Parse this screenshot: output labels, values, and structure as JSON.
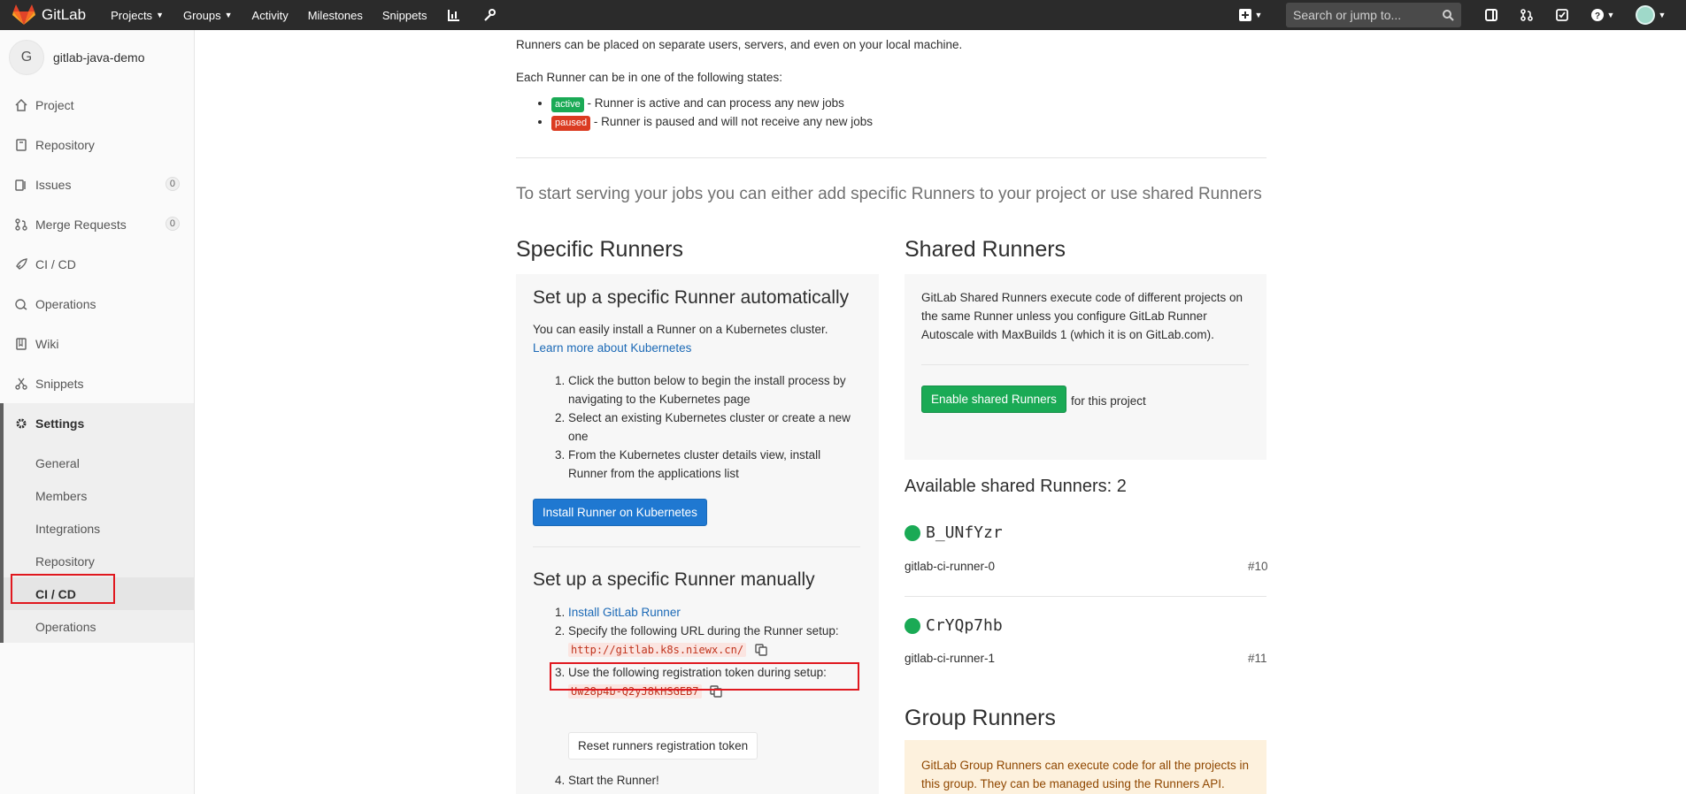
{
  "navbar": {
    "brand": "GitLab",
    "links": [
      "Projects",
      "Groups",
      "Activity",
      "Milestones",
      "Snippets"
    ],
    "search_placeholder": "Search or jump to...",
    "accent": "#2b2b2b"
  },
  "sidebar": {
    "avatar_letter": "G",
    "project_name": "gitlab-java-demo",
    "items": [
      {
        "label": "Project",
        "icon": "home-icon"
      },
      {
        "label": "Repository",
        "icon": "doc-icon"
      },
      {
        "label": "Issues",
        "icon": "issues-icon",
        "count": "0"
      },
      {
        "label": "Merge Requests",
        "icon": "merge-icon",
        "count": "0"
      },
      {
        "label": "CI / CD",
        "icon": "rocket-icon"
      },
      {
        "label": "Operations",
        "icon": "cloud-icon"
      },
      {
        "label": "Wiki",
        "icon": "book-icon"
      },
      {
        "label": "Snippets",
        "icon": "scissors-icon"
      }
    ],
    "settings_label": "Settings",
    "sub_items": [
      "General",
      "Members",
      "Integrations",
      "Repository",
      "CI / CD",
      "Operations"
    ],
    "active_sub": "CI / CD"
  },
  "intro": {
    "line1": "Runners can be placed on separate users, servers, and even on your local machine.",
    "states_heading": "Each Runner can be in one of the following states:",
    "active_badge": "active",
    "active_text": " - Runner is active and can process any new jobs",
    "paused_badge": "paused",
    "paused_text": " - Runner is paused and will not receive any new jobs",
    "lead": "To start serving your jobs you can either add specific Runners to your project or use shared Runners"
  },
  "specific": {
    "heading": "Specific Runners",
    "auto_title": "Set up a specific Runner automatically",
    "auto_desc": "You can easily install a Runner on a Kubernetes cluster.",
    "auto_link": "Learn more about Kubernetes",
    "auto_steps": [
      "Click the button below to begin the install process by navigating to the Kubernetes page",
      "Select an existing Kubernetes cluster or create a new one",
      "From the Kubernetes cluster details view, install Runner from the applications list"
    ],
    "install_button": "Install Runner on Kubernetes",
    "manual_title": "Set up a specific Runner manually",
    "manual_step1_link": "Install GitLab Runner",
    "manual_step2": "Specify the following URL during the Runner setup:",
    "url": "http://gitlab.k8s.niewx.cn/",
    "manual_step3": "Use the following registration token during setup:",
    "token": "Uw28p4b-Q2yJ8kHSGEB7",
    "reset_button": "Reset runners registration token",
    "manual_step4": "Start the Runner!"
  },
  "shared": {
    "heading": "Shared Runners",
    "desc": "GitLab Shared Runners execute code of different projects on the same Runner unless you configure GitLab Runner Autoscale with MaxBuilds 1 (which it is on GitLab.com).",
    "enable_button": "Enable shared Runners",
    "enable_suffix": "for this project",
    "available": "Available shared Runners: 2",
    "runners": [
      {
        "token": "B_UNfYzr",
        "name": "gitlab-ci-runner-0",
        "id": "#10"
      },
      {
        "token": "CrYQp7hb",
        "name": "gitlab-ci-runner-1",
        "id": "#11"
      }
    ]
  },
  "group": {
    "heading": "Group Runners",
    "desc": "GitLab Group Runners can execute code for all the projects in this group. They can be managed using the Runners API."
  }
}
